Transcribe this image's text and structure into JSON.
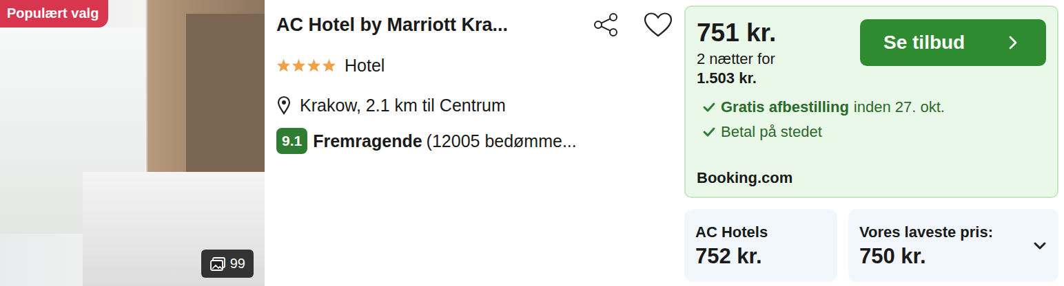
{
  "badge": "Populært valg",
  "photo_count": "99",
  "title": "AC Hotel by Marriott Kra...",
  "stars": 4,
  "type": "Hotel",
  "location": "Krakow, 2.1 km til Centrum",
  "rating": {
    "score": "9.1",
    "label": "Fremragende",
    "reviews": "(12005 bedømme..."
  },
  "offer": {
    "price": "751 kr.",
    "nights_label": "2 nætter for",
    "total": "1.503 kr.",
    "button": "Se tilbud",
    "features": [
      {
        "parts": [
          {
            "text": "Gratis afbestilling",
            "bold": true
          },
          {
            "text": "inden 27. okt.",
            "bold": false
          }
        ]
      },
      {
        "parts": [
          {
            "text": "Betal på stedet",
            "bold": false
          }
        ]
      }
    ],
    "provider": "Booking.com"
  },
  "alternatives": [
    {
      "label": "AC Hotels",
      "price": "752 kr.",
      "expandable": false
    },
    {
      "label": "Vores laveste pris:",
      "price": "750 kr.",
      "expandable": true
    }
  ]
}
